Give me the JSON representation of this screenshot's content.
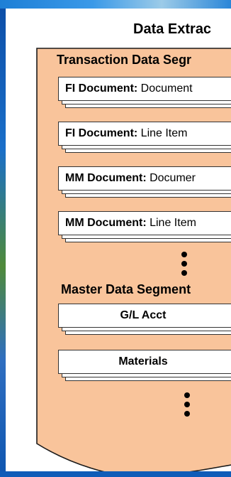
{
  "diagram": {
    "title": "Data Extrac",
    "transaction_segment": {
      "title": "Transaction Data Segr",
      "items": [
        {
          "bold": "FI Document:",
          "text": " Document"
        },
        {
          "bold": "FI Document:",
          "text": " Line Item"
        },
        {
          "bold": "MM Document:",
          "text": " Documer"
        },
        {
          "bold": "MM Document:",
          "text": " Line Item"
        }
      ]
    },
    "master_segment": {
      "title": "Master Data Segment",
      "items": [
        {
          "label": "G/L Acct"
        },
        {
          "label": "Materials"
        }
      ]
    },
    "colors": {
      "scroll_fill": "#f9c49b",
      "scroll_stroke": "#1a1a1a",
      "frame_background": "#1565c0"
    }
  }
}
